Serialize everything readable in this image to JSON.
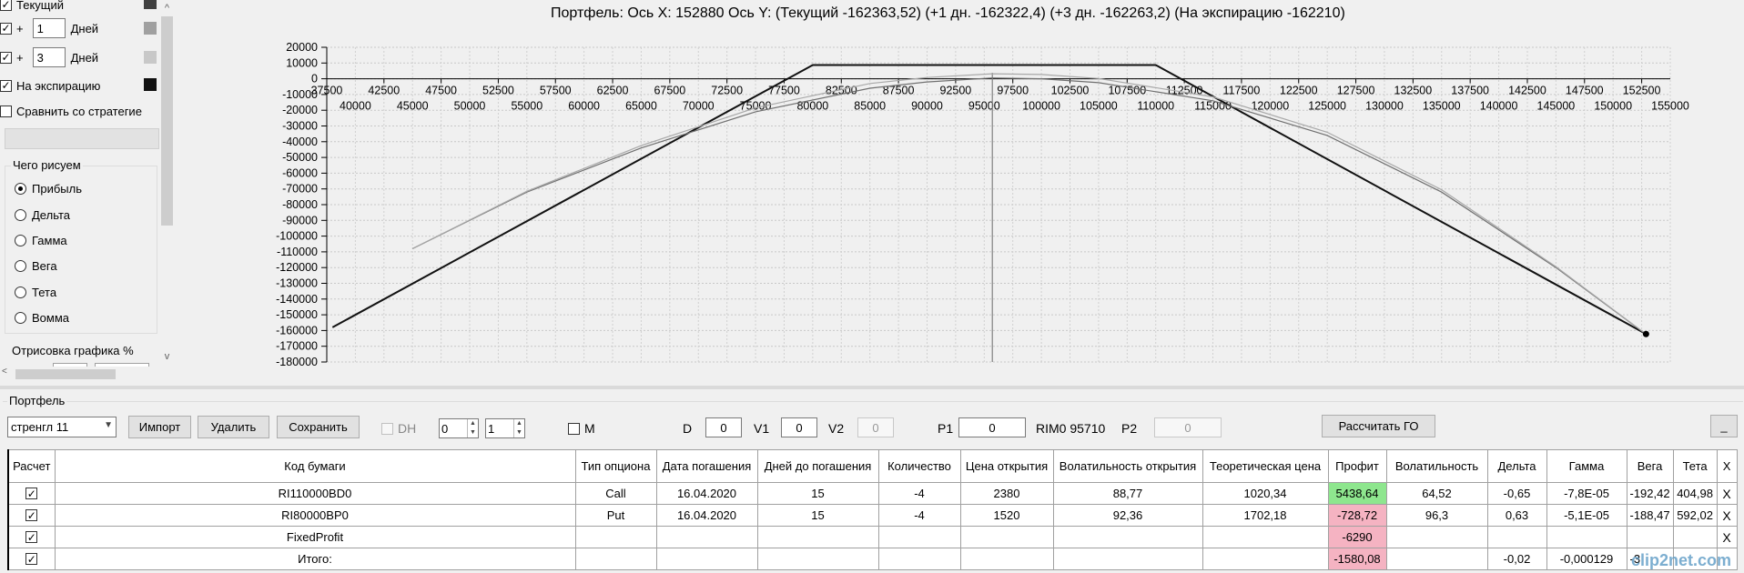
{
  "left_panel": {
    "rows": [
      {
        "type": "checkbox",
        "checked": true,
        "label": "Текущий",
        "swatch": "#404040"
      },
      {
        "type": "days",
        "checked": true,
        "prefix": "+",
        "value": "1",
        "suffix": "Дней",
        "swatch": "#a0a0a0"
      },
      {
        "type": "days",
        "checked": true,
        "prefix": "+",
        "value": "3",
        "suffix": "Дней",
        "swatch": "#c8c8c8"
      },
      {
        "type": "checkbox",
        "checked": true,
        "label": "На экспирацию",
        "swatch": "#111111"
      },
      {
        "type": "checkbox",
        "checked": false,
        "label": "Сравнить со стратегие"
      }
    ],
    "group_title": "Чего рисуем",
    "radios": [
      {
        "label": "Прибыль",
        "checked": true
      },
      {
        "label": "Дельта",
        "checked": false
      },
      {
        "label": "Гамма",
        "checked": false
      },
      {
        "label": "Вега",
        "checked": false
      },
      {
        "label": "Тета",
        "checked": false
      },
      {
        "label": "Вомма",
        "checked": false
      }
    ],
    "render_label": "Отрисовка графика %"
  },
  "chart": {
    "title": "Портфель: Ось X: 152880 Ось Y:  (Текущий -162363,52)  (+1 дн. -162322,4)  (+3 дн. -162263,2)  (На экспирацию -162210)"
  },
  "chart_data": {
    "type": "line",
    "title": "Портфель: Ось X: 152880 Ось Y:  (Текущий -162363,52)  (+1 дн. -162322,4)  (+3 дн. -162263,2)  (На экспирацию -162210)",
    "xlabel": "",
    "ylabel": "",
    "xlim": [
      37500,
      155000
    ],
    "ylim": [
      -180000,
      20000
    ],
    "x_ticks_upper": [
      37500,
      42500,
      47500,
      52500,
      57500,
      62500,
      67500,
      72500,
      77500,
      82500,
      87500,
      92500,
      97500,
      102500,
      107500,
      112500,
      117500,
      122500,
      127500,
      132500,
      137500,
      142500,
      147500,
      152500
    ],
    "x_ticks_lower": [
      40000,
      45000,
      50000,
      55000,
      60000,
      65000,
      70000,
      75000,
      80000,
      85000,
      90000,
      95000,
      100000,
      105000,
      110000,
      115000,
      120000,
      125000,
      130000,
      135000,
      140000,
      145000,
      150000,
      155000
    ],
    "y_ticks": [
      20000,
      10000,
      0,
      -10000,
      -20000,
      -30000,
      -40000,
      -50000,
      -60000,
      -70000,
      -80000,
      -90000,
      -100000,
      -110000,
      -120000,
      -130000,
      -140000,
      -150000,
      -160000,
      -170000,
      -180000
    ],
    "grid": true,
    "vertical_line_x": 95710,
    "marker": {
      "x": 152880,
      "y": -162210
    },
    "series": [
      {
        "color": "#111111",
        "width": 2,
        "x": [
          38000,
          80000,
          110000,
          152880
        ],
        "y": [
          -158000,
          8710,
          8710,
          -162210
        ]
      },
      {
        "color": "#707070",
        "width": 1.2,
        "x": [
          45000,
          55000,
          65000,
          75000,
          85000,
          90000,
          95710,
          100000,
          105000,
          115000,
          125000,
          135000,
          145000,
          152880
        ],
        "y": [
          -108000,
          -72000,
          -44000,
          -21000,
          -6000,
          -2000,
          500,
          0,
          -2500,
          -14000,
          -36000,
          -72000,
          -120000,
          -162363
        ]
      },
      {
        "color": "#a8a8a8",
        "width": 1.2,
        "x": [
          45000,
          55000,
          65000,
          75000,
          85000,
          90000,
          95710,
          100000,
          105000,
          115000,
          125000,
          135000,
          145000,
          152880
        ],
        "y": [
          -108000,
          -71500,
          -42500,
          -18500,
          -3000,
          800,
          3200,
          2700,
          200,
          -11500,
          -34000,
          -70500,
          -119500,
          -162263
        ]
      }
    ]
  },
  "portfolio": {
    "label": "Портфель",
    "strategy": "стренгл 11",
    "buttons": {
      "import": "Импорт",
      "delete": "Удалить",
      "save": "Сохранить",
      "calc_go": "Рассчитать ГО",
      "minimize": "_"
    },
    "dh_label": "DH",
    "spin1": "0",
    "spin2": "1",
    "m_label": "M",
    "d_label": "D",
    "d_value": "0",
    "v1_label": "V1",
    "v1_value": "0",
    "v2_label": "V2",
    "v2_value": "0",
    "p1_label": "P1",
    "p1_value": "0",
    "ticker_info": "RIM0 95710",
    "p2_label": "P2",
    "p2_value": "0"
  },
  "table": {
    "headers": [
      "Расчет",
      "Код бумаги",
      "Тип опциона",
      "Дата погашения",
      "Дней до погашения",
      "Количество",
      "Цена открытия",
      "Волатильность открытия",
      "Теоретическая цена",
      "Профит",
      "Волатильность",
      "Дельта",
      "Гамма",
      "Вега",
      "Тета",
      "X"
    ],
    "rows": [
      {
        "check": true,
        "code": "RI110000BD0",
        "type": "Call",
        "date": "16.04.2020",
        "days": "15",
        "qty": "-4",
        "open_price": "2380",
        "open_vol": "88,77",
        "theo": "1020,34",
        "profit": "5438,64",
        "profit_state": "pos",
        "vol": "64,52",
        "delta": "-0,65",
        "gamma": "-7,8E-05",
        "vega": "-192,42",
        "theta": "404,98",
        "x": "X"
      },
      {
        "check": true,
        "code": "RI80000BP0",
        "type": "Put",
        "date": "16.04.2020",
        "days": "15",
        "qty": "-4",
        "open_price": "1520",
        "open_vol": "92,36",
        "theo": "1702,18",
        "profit": "-728,72",
        "profit_state": "neg",
        "vol": "96,3",
        "delta": "0,63",
        "gamma": "-5,1E-05",
        "vega": "-188,47",
        "theta": "592,02",
        "x": "X"
      },
      {
        "check": true,
        "code": "FixedProfit",
        "type": "",
        "date": "",
        "days": "",
        "qty": "",
        "open_price": "",
        "open_vol": "",
        "theo": "",
        "profit": "-6290",
        "profit_state": "neg",
        "vol": "",
        "delta": "",
        "gamma": "",
        "vega": "",
        "theta": "",
        "x": "X"
      },
      {
        "check": true,
        "code": "Итого:",
        "type": "",
        "date": "",
        "days": "",
        "qty": "",
        "open_price": "",
        "open_vol": "",
        "theo": "",
        "profit": "-1580,08",
        "profit_state": "neg",
        "vol": "",
        "delta": "-0,02",
        "gamma": "-0,000129",
        "vega": "-3",
        "theta": "",
        "x": ""
      }
    ]
  },
  "watermark": "clip2net.com"
}
